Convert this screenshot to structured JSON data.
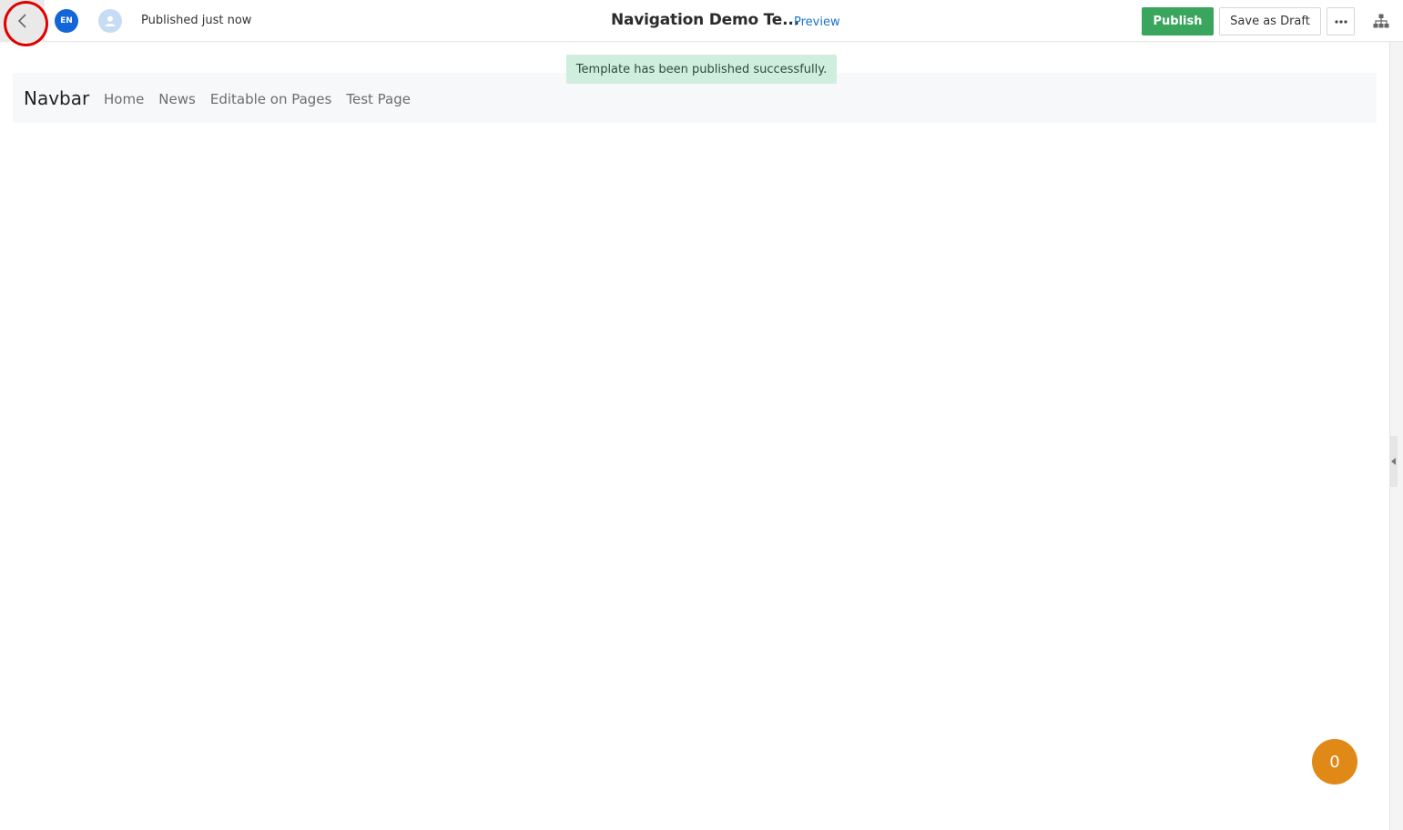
{
  "header": {
    "back_icon": "chevron-left-icon",
    "language": "EN",
    "avatar_icon": "user-icon",
    "status": "Published just now",
    "title": "Navigation Demo Te...",
    "preview_label": "Preview",
    "publish_label": "Publish",
    "save_draft_label": "Save as Draft",
    "more_icon": "more-horizontal-icon",
    "sitemap_icon": "sitemap-icon"
  },
  "toast": {
    "message": "Template has been published successfully."
  },
  "navbar": {
    "brand": "Navbar",
    "links": [
      {
        "label": "Home"
      },
      {
        "label": "News"
      },
      {
        "label": "Editable on Pages"
      },
      {
        "label": "Test Page"
      }
    ]
  },
  "counter": {
    "value": "0"
  },
  "colors": {
    "publish": "#3aa55d",
    "toast_bg": "#cfeedd",
    "language_badge": "#1266d8",
    "counter_bg": "#e08916",
    "highlight_ring": "#e10000",
    "link": "#1a73c6"
  }
}
